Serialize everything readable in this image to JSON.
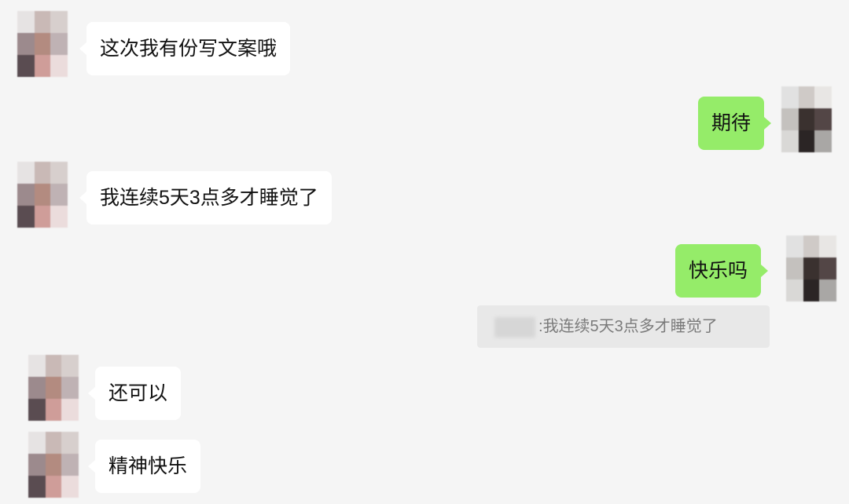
{
  "messages": [
    {
      "side": "in",
      "text": "这次我有份写文案哦"
    },
    {
      "side": "out",
      "text": "期待"
    },
    {
      "side": "in",
      "text": "我连续5天3点多才睡觉了"
    },
    {
      "side": "out",
      "text": "快乐吗"
    },
    {
      "side": "in",
      "text": "还可以"
    },
    {
      "side": "in",
      "text": "精神快乐"
    }
  ],
  "quote": {
    "separator": ":",
    "text": "我连续5天3点多才睡觉了"
  },
  "colors": {
    "background": "#f5f5f5",
    "incoming_bubble": "#ffffff",
    "outgoing_bubble": "#95ec69",
    "quote_background": "#e8e8e8"
  },
  "icons": {
    "contact_avatar": "pixelated-avatar",
    "self_avatar": "pixelated-avatar"
  }
}
